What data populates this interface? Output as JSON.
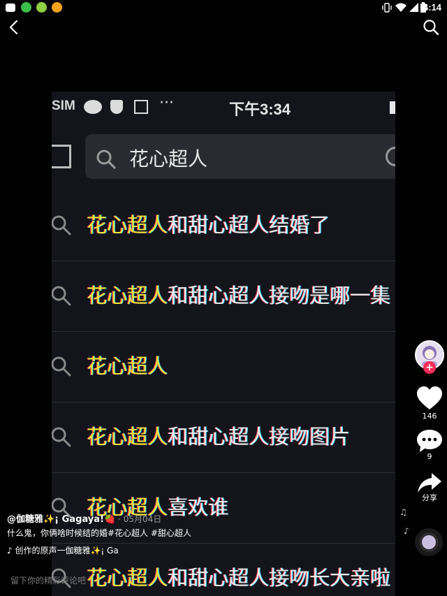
{
  "status_bar": {
    "time": "4:14",
    "app_icons": [
      "mail-icon",
      "chat-icon",
      "green-app-icon",
      "uc-browser-icon"
    ],
    "system_icons": [
      "vibrate-icon",
      "wifi-icon",
      "signal-icon",
      "battery-icon"
    ]
  },
  "video": {
    "status_sim": "SIM",
    "status_time": "下午3:34",
    "search_query": "花心超人",
    "suggestions": [
      {
        "highlight": "花心超人",
        "rest": "和甜心超人结婚了"
      },
      {
        "highlight": "花心超人",
        "rest": "和甜心超人接吻是哪一集"
      },
      {
        "highlight": "花心超人",
        "rest": ""
      },
      {
        "highlight": "花心超人",
        "rest": "和甜心超人接吻图片"
      },
      {
        "highlight": "花心超人",
        "rest": "喜欢谁"
      },
      {
        "highlight": "花心超人",
        "rest": "和甜心超人接吻长大亲啦"
      }
    ]
  },
  "sidebar": {
    "likes": "146",
    "comments": "9",
    "share_label": "分享"
  },
  "post": {
    "author": "@伽糖雅✨¡ Gagaya!🍓",
    "date": "· 05月04日",
    "description": "什么鬼，你俩啥时候结的婚#花心超人 #甜心超人",
    "music": "♪ 创作的原声一伽糖雅✨¡ Ga"
  },
  "comment": {
    "placeholder": "留下你的精彩评论吧"
  },
  "colors": {
    "background": "#000000",
    "highlight": "#f3e23a",
    "follow_badge": "#fe2c55"
  }
}
